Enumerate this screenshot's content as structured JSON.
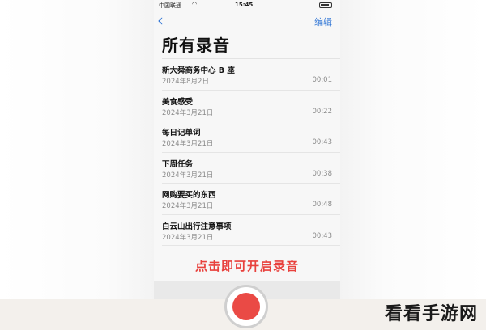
{
  "status_bar": {
    "carrier": "中国联通",
    "time": "15:45"
  },
  "nav": {
    "back_icon": "‹",
    "edit_label": "编辑"
  },
  "page_title": "所有录音",
  "recordings": [
    {
      "name": "新大舜商务中心 B 座",
      "date": "2024年8月2日",
      "duration": "00:01"
    },
    {
      "name": "美食感受",
      "date": "2024年3月21日",
      "duration": "00:22"
    },
    {
      "name": "每日记单词",
      "date": "2024年3月21日",
      "duration": "00:43"
    },
    {
      "name": "下周任务",
      "date": "2024年3月21日",
      "duration": "00:38"
    },
    {
      "name": "网购要买的东西",
      "date": "2024年3月21日",
      "duration": "00:48"
    },
    {
      "name": "白云山出行注意事项",
      "date": "2024年3月21日",
      "duration": "00:43"
    }
  ],
  "overlay_hint": "点击即可开启录音",
  "watermark": "看看手游网",
  "colors": {
    "accent": "#3478d6",
    "record": "#ea4a45",
    "hint": "#e8413d"
  }
}
